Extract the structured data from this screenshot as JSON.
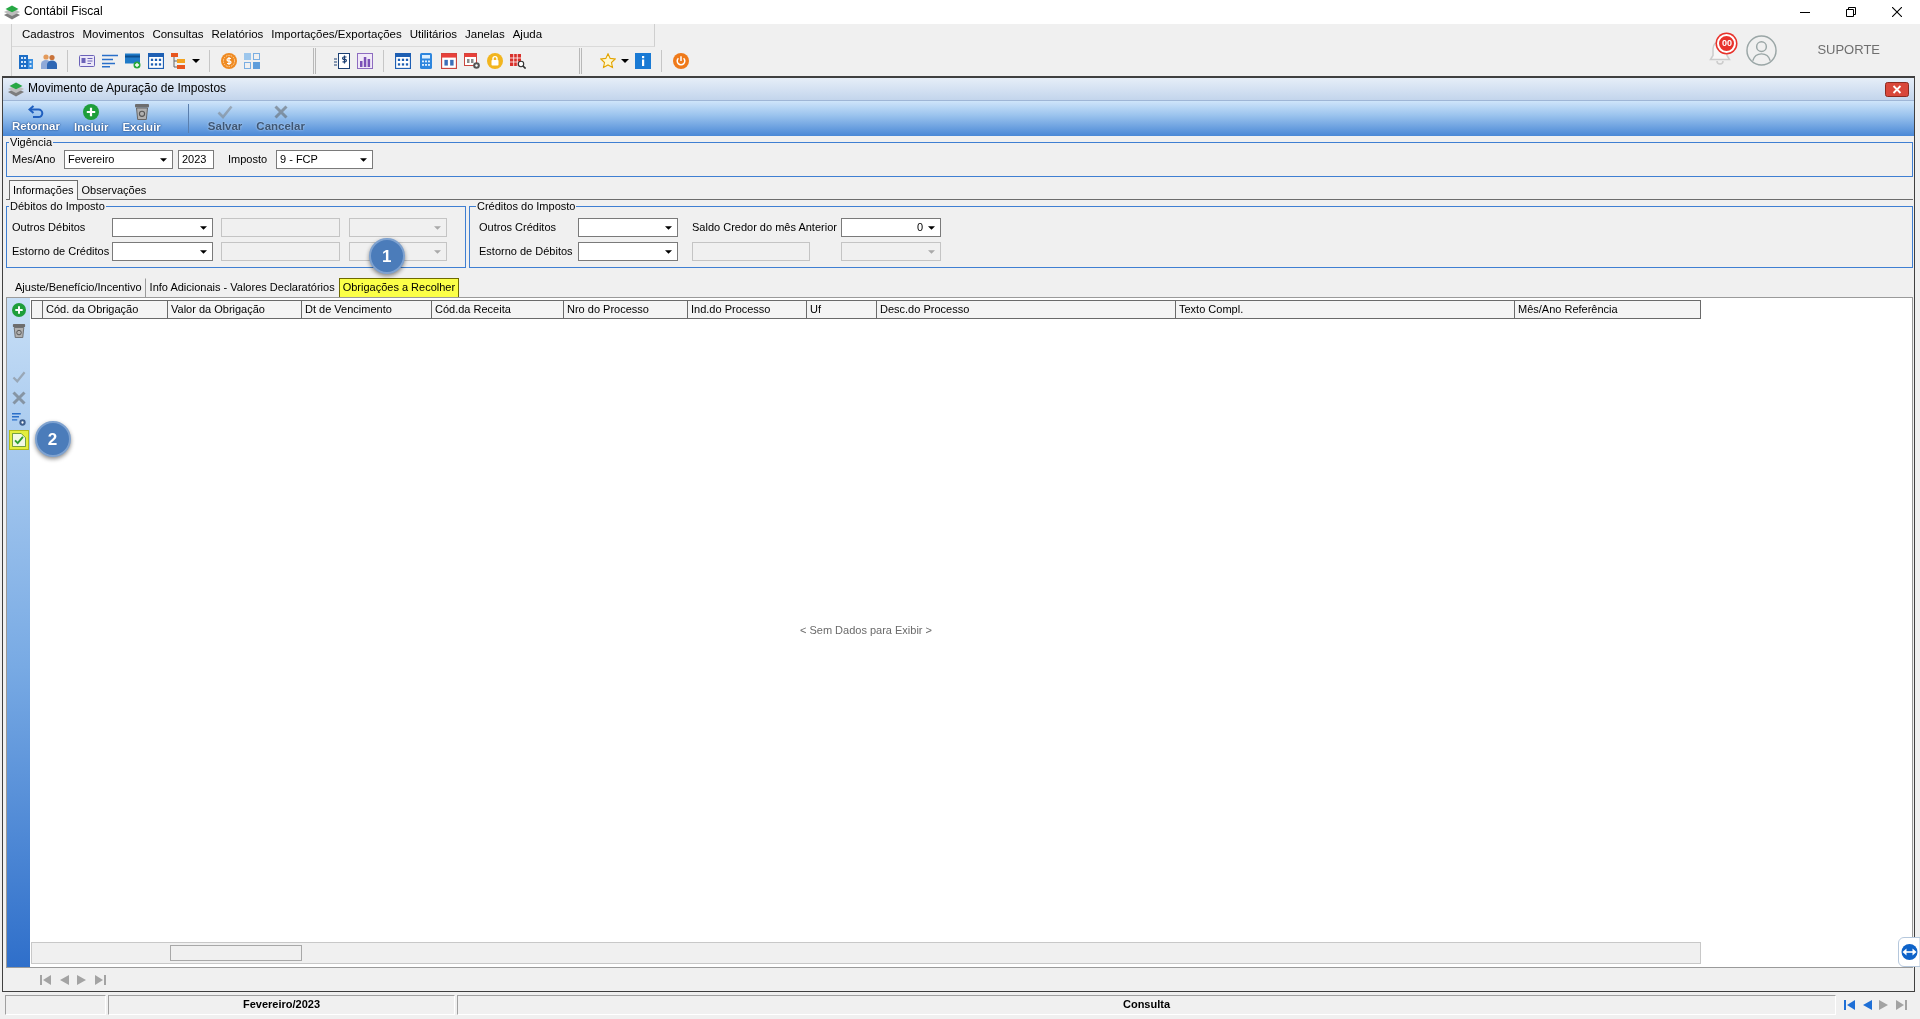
{
  "app": {
    "title": "Contábil Fiscal",
    "menu": [
      "Cadastros",
      "Movimentos",
      "Consultas",
      "Relatórios",
      "Importações/Exportações",
      "Utilitários",
      "Janelas",
      "Ajuda"
    ],
    "notification_count": "00",
    "user": "SUPORTE"
  },
  "window": {
    "title": "Movimento de Apuração de Impostos",
    "toolbar_groups": [
      [
        {
          "kind": "return",
          "label": "Retornar",
          "disabled": false
        },
        {
          "kind": "add",
          "label": "Incluir",
          "disabled": false
        },
        {
          "kind": "delete",
          "label": "Excluir",
          "disabled": false
        }
      ],
      [
        {
          "kind": "save",
          "label": "Salvar",
          "disabled": true
        },
        {
          "kind": "cancel",
          "label": "Cancelar",
          "disabled": true
        }
      ]
    ]
  },
  "vigencia": {
    "legend": "Vigência",
    "fields": [
      {
        "kind": "label",
        "text": "Mes/Ano"
      },
      {
        "kind": "dropdown",
        "value": "Fevereiro",
        "disabled": false
      },
      {
        "kind": "text",
        "value": "2023",
        "disabled": false
      },
      {
        "kind": "label",
        "text": "Imposto"
      },
      {
        "kind": "dropdown",
        "value": "9 - FCP",
        "disabled": false
      }
    ]
  },
  "tabs": [
    {
      "label": "Informações",
      "selected": true
    },
    {
      "label": "Observações",
      "selected": false
    }
  ],
  "debitos": {
    "legend": "Débitos do Imposto",
    "rows": [
      {
        "label": "Outros Débitos",
        "fields": [
          {
            "kind": "dropdown",
            "disabled": false
          },
          {
            "kind": "text",
            "disabled": true
          },
          {
            "kind": "dropdown",
            "disabled": true
          }
        ]
      },
      {
        "label": "Estorno de Créditos",
        "fields": [
          {
            "kind": "dropdown",
            "disabled": false
          },
          {
            "kind": "text",
            "disabled": true
          },
          {
            "kind": "dropdown",
            "disabled": true
          }
        ]
      }
    ]
  },
  "creditos": {
    "legend": "Créditos do Imposto",
    "rows": [
      {
        "label": "Outros Créditos",
        "fields": [
          {
            "kind": "dropdown",
            "disabled": false
          },
          {
            "kind": "label",
            "text": "Saldo Credor do mês Anterior"
          },
          {
            "kind": "numeric-dropdown",
            "value": "0",
            "disabled": false
          }
        ]
      },
      {
        "label": "Estorno de Débitos",
        "fields": [
          {
            "kind": "dropdown",
            "disabled": false
          },
          {
            "kind": "text",
            "disabled": true
          },
          {
            "kind": "dropdown",
            "disabled": true
          }
        ]
      }
    ]
  },
  "detail_tabs": [
    {
      "label": "Ajuste/Benefício/Incentivo",
      "selected": false,
      "highlighted": false
    },
    {
      "label": "Info Adicionais - Valores Declaratórios",
      "selected": false,
      "highlighted": false
    },
    {
      "label": "Obrigações a Recolher",
      "selected": true,
      "highlighted": true,
      "callout": "1"
    }
  ],
  "grid": {
    "tool_groups": [
      [
        {
          "kind": "add",
          "disabled": false,
          "highlighted": false
        },
        {
          "kind": "delete",
          "disabled": false,
          "highlighted": false
        }
      ],
      [
        {
          "kind": "confirm",
          "disabled": true,
          "highlighted": false
        },
        {
          "kind": "cancel",
          "disabled": true,
          "highlighted": false
        },
        {
          "kind": "list-settings",
          "disabled": false,
          "highlighted": false
        },
        {
          "kind": "checklist",
          "disabled": false,
          "highlighted": true,
          "callout": "2"
        }
      ]
    ],
    "columns": [
      "Cód. da Obrigação",
      "Valor da Obrigação",
      "Dt de Vencimento",
      "Cód.da Receita",
      "Nro do Processo",
      "Ind.do Processo",
      "Uf",
      "Desc.do Processo",
      "Texto Compl.",
      "Mês/Ano Referência"
    ],
    "empty_text": "< Sem Dados para Exibir >",
    "nav": [
      {
        "kind": "first",
        "disabled": true
      },
      {
        "kind": "previous",
        "disabled": true
      },
      {
        "kind": "next",
        "disabled": true
      },
      {
        "kind": "last",
        "disabled": true
      }
    ]
  },
  "status_bar": {
    "period": "Fevereiro/2023",
    "mode": "Consulta",
    "nav": [
      {
        "kind": "first",
        "disabled": false
      },
      {
        "kind": "previous",
        "disabled": false
      },
      {
        "kind": "next",
        "disabled": true
      },
      {
        "kind": "last",
        "disabled": true
      }
    ]
  }
}
